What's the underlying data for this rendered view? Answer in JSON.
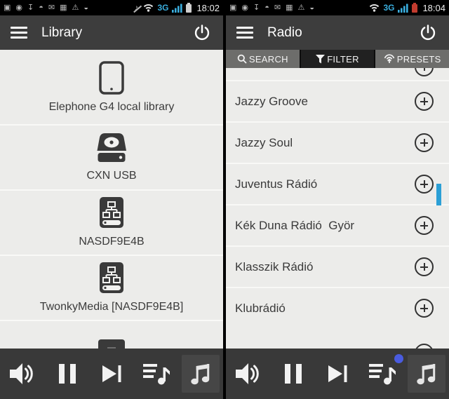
{
  "left_panel": {
    "status": {
      "time": "18:02",
      "network": "3G"
    },
    "header": {
      "title": "Library"
    },
    "library_items": [
      {
        "label": "Elephone G4 local library",
        "icon": "phone"
      },
      {
        "label": "CXN USB",
        "icon": "hard-drive"
      },
      {
        "label": "NASDF9E4B",
        "icon": "nas-drive"
      },
      {
        "label": "TwonkyMedia [NASDF9E4B]",
        "icon": "nas-drive"
      }
    ]
  },
  "right_panel": {
    "status": {
      "time": "18:04",
      "network": "3G"
    },
    "header": {
      "title": "Radio"
    },
    "tabs": [
      {
        "label": "SEARCH",
        "icon": "search"
      },
      {
        "label": "FILTER",
        "icon": "filter",
        "active": true
      },
      {
        "label": "PRESETS",
        "icon": "presets"
      }
    ],
    "stations": [
      {
        "name": "Jazzy Groove"
      },
      {
        "name": "Jazzy Soul"
      },
      {
        "name": "Juventus Rádió"
      },
      {
        "name": "Kék Duna Rádió  Györ"
      },
      {
        "name": "Klasszik Rádió"
      },
      {
        "name": "Klubrádió"
      }
    ]
  },
  "status_icons": {
    "screenshot": "▣",
    "app_circle": "◉",
    "download": "↧",
    "chat": "◓",
    "mail": "✉",
    "gallery": "▦",
    "warning": "⚠",
    "data_sync": "◒",
    "muted_note": "♪"
  },
  "colors": {
    "signal_blue": "#3aaede",
    "scrollbar_blue": "#2b9fd6",
    "queue_badge_blue": "#4a5ce0",
    "battery_low_red": "#c23b2e",
    "header_gray": "#3d3d3d",
    "list_bg": "#ececea",
    "toolbar_gray": "#393939"
  }
}
